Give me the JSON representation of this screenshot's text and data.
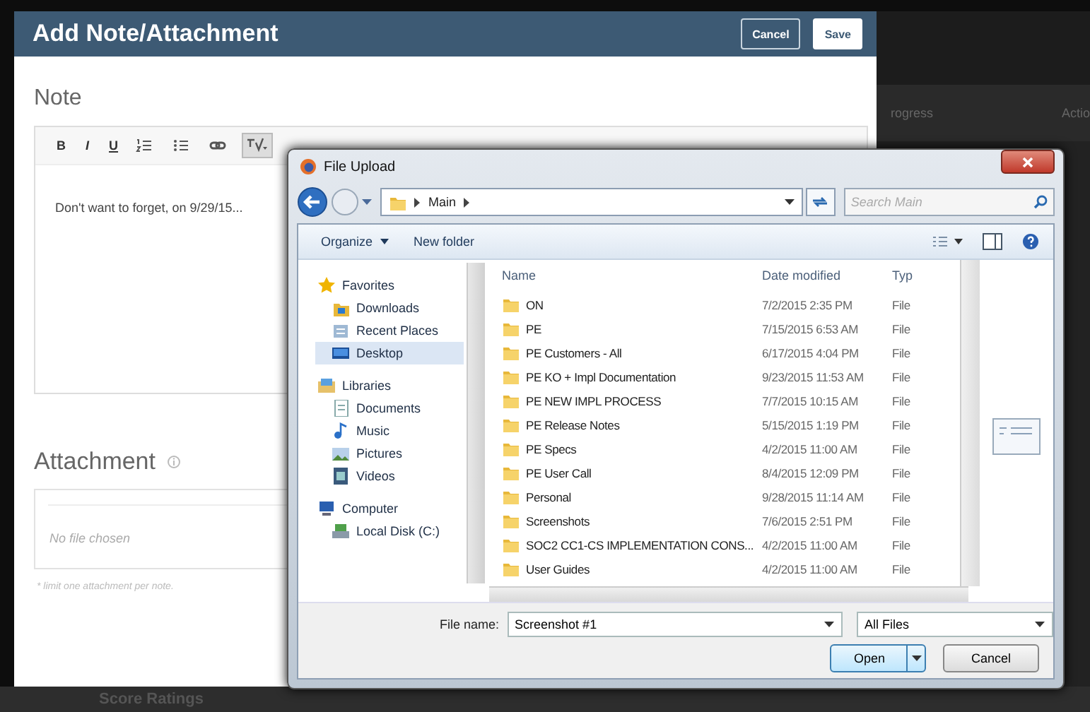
{
  "modal": {
    "title": "Add Note/Attachment",
    "buttons": [
      {
        "label": "Cancel",
        "kind": "outline"
      },
      {
        "label": "Save",
        "kind": "solid"
      }
    ],
    "note": {
      "heading": "Note",
      "tools": [
        {
          "kind": "bold",
          "label": "B",
          "selected": false
        },
        {
          "kind": "italic",
          "label": "I",
          "selected": false
        },
        {
          "kind": "underline",
          "label": "U",
          "selected": false
        },
        {
          "kind": "ordered-list",
          "selected": false
        },
        {
          "kind": "bullet-list",
          "selected": false
        },
        {
          "kind": "link",
          "selected": false
        },
        {
          "kind": "spellcheck",
          "selected": true
        }
      ],
      "text": "Don't want to forget, on 9/29/15..."
    },
    "attachment": {
      "heading": "Attachment",
      "placeholder": "No file chosen",
      "hint": "* limit one attachment per note."
    }
  },
  "background": {
    "columns": [
      "rogress",
      "Actio"
    ],
    "footer": "Score Ratings"
  },
  "dialog": {
    "title": "File Upload",
    "path": [
      "Main"
    ],
    "search": {
      "placeholder": "Search Main"
    },
    "toolbar": [
      {
        "label": "Organize",
        "kind": "menu"
      },
      {
        "label": "New folder",
        "kind": "plain"
      }
    ],
    "nav": [
      {
        "label": "Favorites",
        "kind": "star",
        "selected": false,
        "children": [
          {
            "label": "Downloads",
            "kind": "download",
            "selected": false
          },
          {
            "label": "Recent Places",
            "kind": "recent",
            "selected": false
          },
          {
            "label": "Desktop",
            "kind": "desktop",
            "selected": true
          }
        ]
      },
      {
        "label": "Libraries",
        "kind": "library",
        "selected": false,
        "children": [
          {
            "label": "Documents",
            "kind": "document",
            "selected": false
          },
          {
            "label": "Music",
            "kind": "music",
            "selected": false
          },
          {
            "label": "Pictures",
            "kind": "picture",
            "selected": false
          },
          {
            "label": "Videos",
            "kind": "video",
            "selected": false
          }
        ]
      },
      {
        "label": "Computer",
        "kind": "computer",
        "selected": false,
        "children": [
          {
            "label": "Local Disk (C:)",
            "kind": "disk",
            "selected": false
          }
        ]
      }
    ],
    "columns": [
      "Name",
      "Date modified",
      "Typ"
    ],
    "rows": [
      {
        "name": "ON",
        "date": "7/2/2015 2:35 PM",
        "type": "File"
      },
      {
        "name": "PE",
        "date": "7/15/2015 6:53 AM",
        "type": "File"
      },
      {
        "name": "PE Customers - All",
        "date": "6/17/2015 4:04 PM",
        "type": "File"
      },
      {
        "name": "PE KO + Impl Documentation",
        "date": "9/23/2015 11:53 AM",
        "type": "File"
      },
      {
        "name": "PE NEW IMPL PROCESS",
        "date": "7/7/2015 10:15 AM",
        "type": "File"
      },
      {
        "name": "PE Release Notes",
        "date": "5/15/2015 1:19 PM",
        "type": "File"
      },
      {
        "name": "PE Specs",
        "date": "4/2/2015 11:00 AM",
        "type": "File"
      },
      {
        "name": "PE User Call",
        "date": "8/4/2015 12:09 PM",
        "type": "File"
      },
      {
        "name": "Personal",
        "date": "9/28/2015 11:14 AM",
        "type": "File"
      },
      {
        "name": "Screenshots",
        "date": "7/6/2015 2:51 PM",
        "type": "File"
      },
      {
        "name": "SOC2 CC1-CS IMPLEMENTATION CONS...",
        "date": "4/2/2015 11:00 AM",
        "type": "File"
      },
      {
        "name": "User Guides",
        "date": "4/2/2015 11:00 AM",
        "type": "File"
      }
    ],
    "file_name": {
      "label": "File name:",
      "value": "Screenshot #1"
    },
    "filter": "All Files",
    "buttons": [
      {
        "label": "Open",
        "kind": "split"
      },
      {
        "label": "Cancel",
        "kind": "plain"
      }
    ]
  }
}
